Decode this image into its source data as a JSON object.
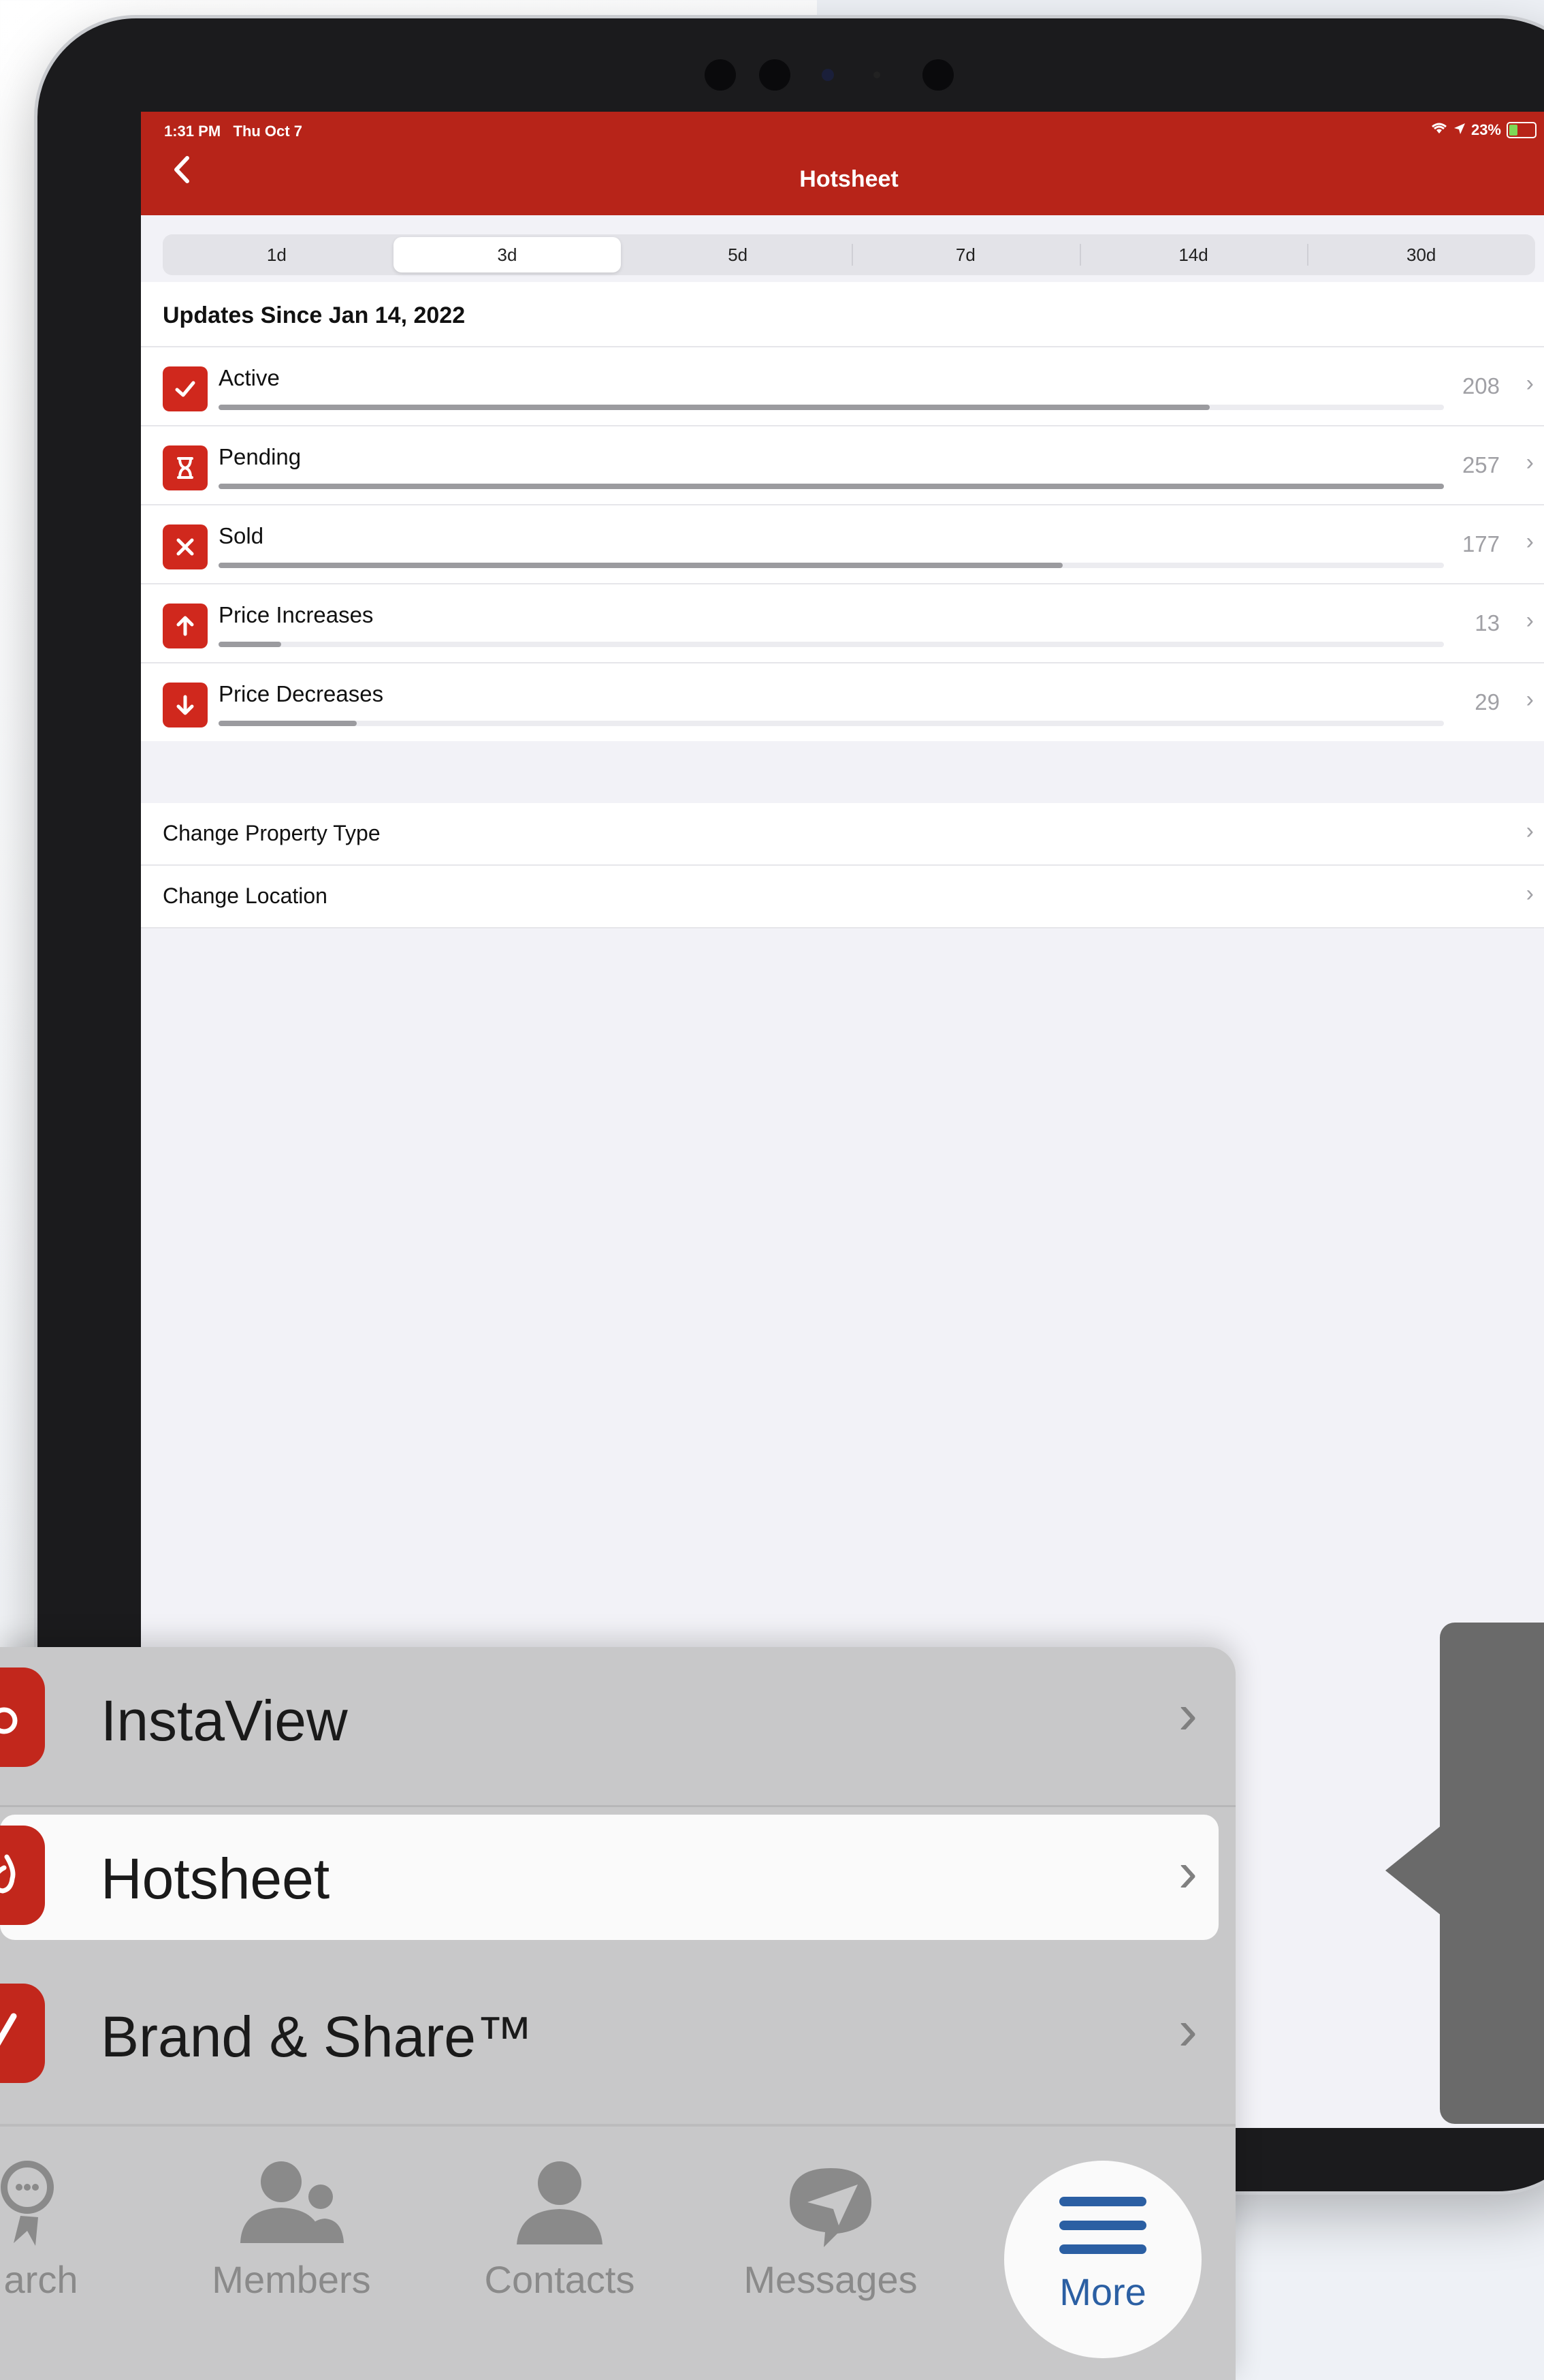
{
  "colors": {
    "brand_red": "#b72419",
    "icon_red": "#d0281d",
    "accent_blue": "#2b5fa3"
  },
  "status_bar": {
    "time": "1:31 PM",
    "date": "Thu Oct 7",
    "battery": "23%"
  },
  "nav": {
    "title": "Hotsheet",
    "back_icon": "chevron-left-icon"
  },
  "segments": [
    {
      "label": "1d",
      "selected": false
    },
    {
      "label": "3d",
      "selected": true
    },
    {
      "label": "5d",
      "selected": false
    },
    {
      "label": "7d",
      "selected": false
    },
    {
      "label": "14d",
      "selected": false
    },
    {
      "label": "30d",
      "selected": false
    }
  ],
  "updates": {
    "header": "Updates Since Jan 14, 2022",
    "max_count": 257,
    "rows": [
      {
        "label": "Active",
        "count": "208",
        "icon": "checkmark-icon",
        "fill": 0.809
      },
      {
        "label": "Pending",
        "count": "257",
        "icon": "hourglass-icon",
        "fill": 1.0
      },
      {
        "label": "Sold",
        "count": "177",
        "icon": "x-mark-icon",
        "fill": 0.689
      },
      {
        "label": "Price Increases",
        "count": "13",
        "icon": "arrow-up-icon",
        "fill": 0.051
      },
      {
        "label": "Price Decreases",
        "count": "29",
        "icon": "arrow-down-icon",
        "fill": 0.113
      }
    ]
  },
  "settings": [
    {
      "label": "Change Property Type"
    },
    {
      "label": "Change Location"
    }
  ],
  "menu": [
    {
      "label": "InstaView",
      "icon": "instaview-icon",
      "highlighted": false
    },
    {
      "label": "Hotsheet",
      "icon": "hotsheet-icon",
      "highlighted": true
    },
    {
      "label": "Brand & Share™",
      "icon": "brand-share-icon",
      "highlighted": false
    }
  ],
  "tabbar": [
    {
      "label": "arch",
      "icon": "search-icon"
    },
    {
      "label": "Members",
      "icon": "members-icon"
    },
    {
      "label": "Contacts",
      "icon": "contact-icon"
    },
    {
      "label": "Messages",
      "icon": "messages-icon"
    },
    {
      "label": "More",
      "icon": "menu-icon",
      "selected": true
    }
  ]
}
